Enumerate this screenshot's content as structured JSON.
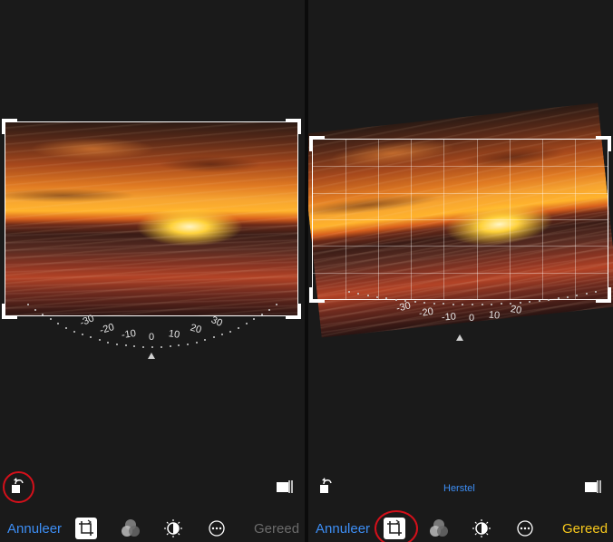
{
  "left_panel": {
    "dial_labels": [
      "-30",
      "-20",
      "-10",
      "0",
      "10",
      "20",
      "30"
    ],
    "toolbar": {
      "cancel": "Annuleer",
      "done": "Gereed"
    },
    "icons": [
      "rotate-left-icon",
      "aspect-ratio-icon",
      "crop-rotate-icon",
      "filters-icon",
      "adjust-icon",
      "more-icon"
    ]
  },
  "right_panel": {
    "dial_labels": [
      "-30",
      "-20",
      "-10",
      "0",
      "10",
      "20"
    ],
    "reset_label": "Herstel",
    "toolbar": {
      "cancel": "Annuleer",
      "done": "Gereed"
    },
    "icons": [
      "rotate-left-icon",
      "aspect-ratio-icon",
      "crop-rotate-icon",
      "filters-icon",
      "adjust-icon",
      "more-icon"
    ]
  },
  "colors": {
    "accent_blue": "#3d8ef5",
    "done_yellow": "#f7c81c",
    "highlight_red": "#d4101a"
  }
}
